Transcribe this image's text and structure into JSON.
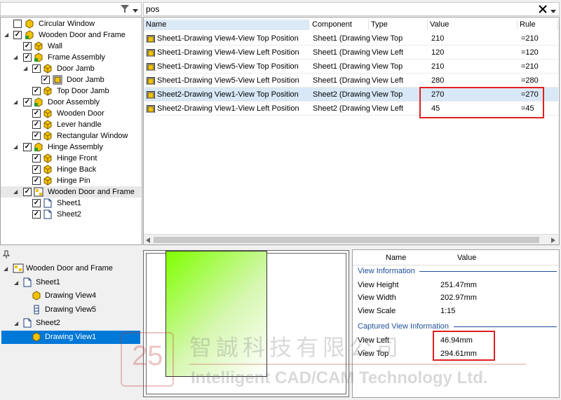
{
  "search": {
    "value": "pos"
  },
  "tree_top": [
    {
      "label": "Circular Window"
    },
    {
      "label": "Wooden Door and Frame"
    },
    {
      "label": "Wall"
    },
    {
      "label": "Frame Assembly"
    },
    {
      "label": "Door Jamb"
    },
    {
      "label": "Door Jamb"
    },
    {
      "label": "Top Door Jamb"
    },
    {
      "label": "Door Assembly"
    },
    {
      "label": "Wooden Door"
    },
    {
      "label": "Lever handle"
    },
    {
      "label": "Rectangular Window"
    },
    {
      "label": "Hinge Assembly"
    },
    {
      "label": "Hinge Front"
    },
    {
      "label": "Hinge Back"
    },
    {
      "label": "Hinge Pin"
    },
    {
      "label": "Wooden Door and Frame"
    },
    {
      "label": "Sheet1"
    },
    {
      "label": "Sheet2"
    }
  ],
  "grid": {
    "headers": [
      "Name",
      "Component",
      "Type",
      "Value",
      "Rule"
    ],
    "rows": [
      {
        "name": "Sheet1-Drawing View4-View Top Position",
        "component": "Sheet1 (Drawing",
        "type": "View Top",
        "value": "210",
        "rule": "=210"
      },
      {
        "name": "Sheet1-Drawing View4-View Left Position",
        "component": "Sheet1 (Drawing",
        "type": "View Left",
        "value": "120",
        "rule": "=120"
      },
      {
        "name": "Sheet1-Drawing View5-View Top Position",
        "component": "Sheet1 (Drawing",
        "type": "View Top",
        "value": "210",
        "rule": "=210"
      },
      {
        "name": "Sheet1-Drawing View5-View Left Position",
        "component": "Sheet1 (Drawing",
        "type": "View Left",
        "value": "280",
        "rule": "=280"
      },
      {
        "name": "Sheet2-Drawing View1-View Top Position",
        "component": "Sheet2 (Drawing",
        "type": "View Top",
        "value": "270",
        "rule": "=270"
      },
      {
        "name": "Sheet2-Drawing View1-View Left Position",
        "component": "Sheet2 (Drawing",
        "type": "View Left",
        "value": "45",
        "rule": "=45"
      }
    ]
  },
  "tree_bottom": [
    {
      "label": "Wooden Door and Frame"
    },
    {
      "label": "Sheet1"
    },
    {
      "label": "Drawing View4"
    },
    {
      "label": "Drawing View5"
    },
    {
      "label": "Sheet2"
    },
    {
      "label": "Drawing View1"
    }
  ],
  "props": {
    "headers": [
      "Name",
      "Value"
    ],
    "section1": "View Information",
    "view_height_label": "View Height",
    "view_height": "251.47mm",
    "view_width_label": "View Width",
    "view_width": "202.97mm",
    "view_scale_label": "View Scale",
    "view_scale": "1:15",
    "section2": "Captured View Information",
    "view_left_label": "View Left",
    "view_left": "46.94mm",
    "view_top_label": "View Top",
    "view_top": "294.61mm"
  },
  "watermark": {
    "chinese": "智誠科技有限公司",
    "english": "Intelligent CAD/CAM Technology Ltd.",
    "badge": "25"
  },
  "colors": {
    "selection": "#0078d7",
    "highlight_box": "#e02020",
    "preview_gradient_start": "#7fff00",
    "preview_gradient_end": "#ffffff",
    "section_text": "#1f4e9a"
  }
}
